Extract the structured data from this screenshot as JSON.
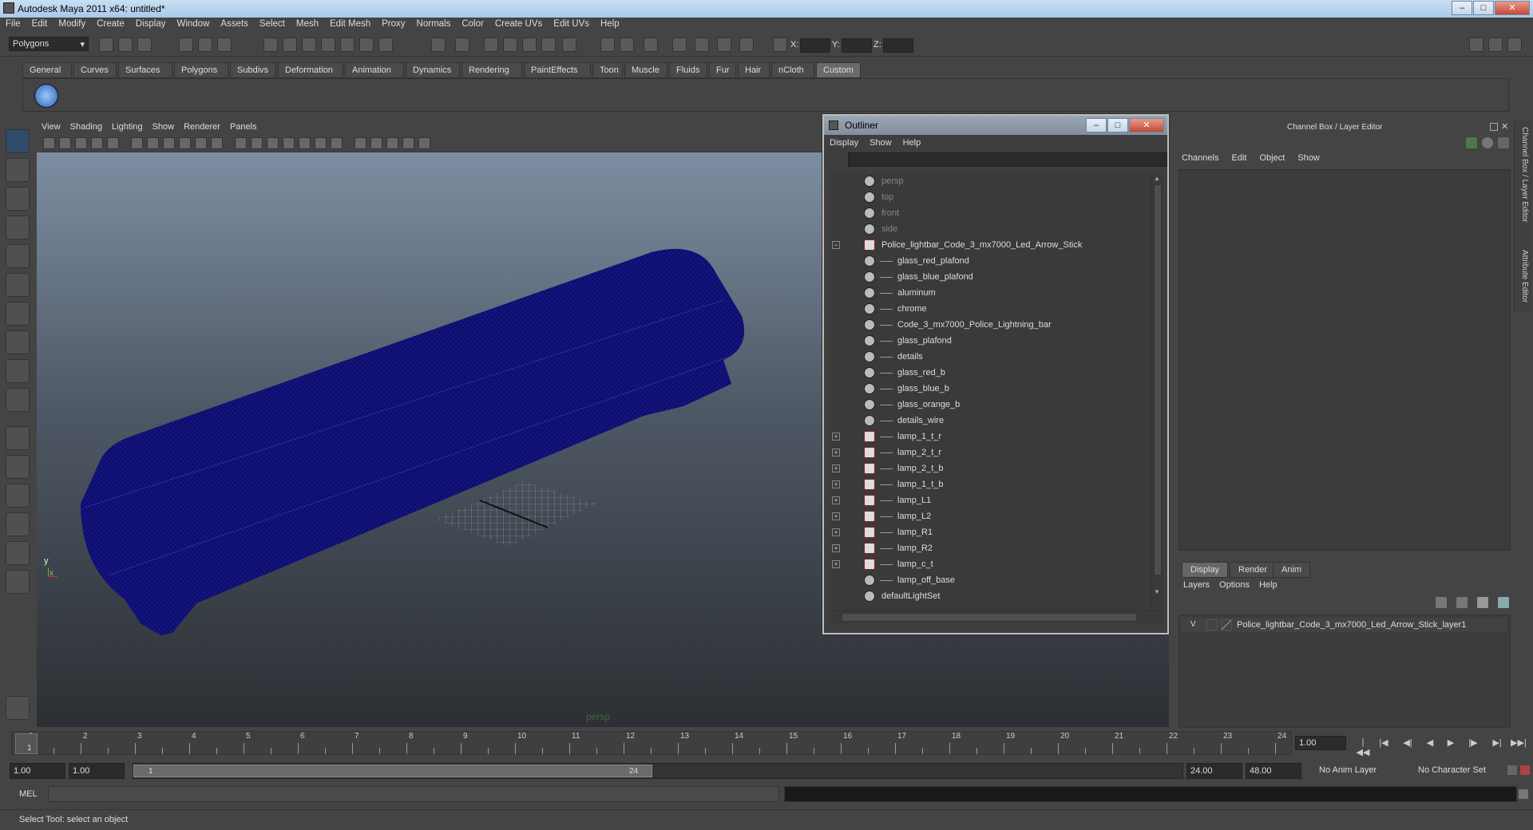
{
  "window": {
    "title": "Autodesk Maya 2011 x64: untitled*",
    "min": "–",
    "max": "□",
    "close": "✕"
  },
  "menubar": [
    "File",
    "Edit",
    "Modify",
    "Create",
    "Display",
    "Window",
    "Assets",
    "Select",
    "Mesh",
    "Edit Mesh",
    "Proxy",
    "Normals",
    "Color",
    "Create UVs",
    "Edit UVs",
    "Help"
  ],
  "statusline": {
    "mode": "Polygons",
    "x_label": "X:",
    "y_label": "Y:",
    "z_label": "Z:"
  },
  "shelf_tabs": [
    "General",
    "Curves",
    "Surfaces",
    "Polygons",
    "Subdivs",
    "Deformation",
    "Animation",
    "Dynamics",
    "Rendering",
    "PaintEffects",
    "Toon",
    "Muscle",
    "Fluids",
    "Fur",
    "Hair",
    "nCloth",
    "Custom"
  ],
  "shelf_active": "Custom",
  "viewport": {
    "menu": [
      "View",
      "Shading",
      "Lighting",
      "Show",
      "Renderer",
      "Panels"
    ],
    "camera_label": "persp",
    "axis_y": "y",
    "axis_x": "x",
    "model_color": "#0d0d6e"
  },
  "outliner": {
    "title": "Outliner",
    "menu": [
      "Display",
      "Show",
      "Help"
    ],
    "items": [
      {
        "label": "persp",
        "type": "camera"
      },
      {
        "label": "top",
        "type": "camera"
      },
      {
        "label": "front",
        "type": "camera"
      },
      {
        "label": "side",
        "type": "camera"
      },
      {
        "label": "Police_lightbar_Code_3_mx7000_Led_Arrow_Stick",
        "type": "group"
      },
      {
        "label": "glass_red_plafond",
        "type": "child"
      },
      {
        "label": "glass_blue_plafond",
        "type": "child"
      },
      {
        "label": "aluminum",
        "type": "child"
      },
      {
        "label": "chrome",
        "type": "child"
      },
      {
        "label": "Code_3_mx7000_Police_Lightning_bar",
        "type": "child"
      },
      {
        "label": "glass_plafond",
        "type": "child"
      },
      {
        "label": "details",
        "type": "child"
      },
      {
        "label": "glass_red_b",
        "type": "child"
      },
      {
        "label": "glass_blue_b",
        "type": "child"
      },
      {
        "label": "glass_orange_b",
        "type": "child"
      },
      {
        "label": "details_wire",
        "type": "child"
      },
      {
        "label": "lamp_1_t_r",
        "type": "subgroup"
      },
      {
        "label": "lamp_2_t_r",
        "type": "subgroup"
      },
      {
        "label": "lamp_2_t_b",
        "type": "subgroup"
      },
      {
        "label": "lamp_1_t_b",
        "type": "subgroup"
      },
      {
        "label": "lamp_L1",
        "type": "subgroup"
      },
      {
        "label": "lamp_L2",
        "type": "subgroup"
      },
      {
        "label": "lamp_R1",
        "type": "subgroup"
      },
      {
        "label": "lamp_R2",
        "type": "subgroup"
      },
      {
        "label": "lamp_c_t",
        "type": "subgroup"
      },
      {
        "label": "lamp_off_base",
        "type": "child"
      },
      {
        "label": "defaultLightSet",
        "type": "set"
      }
    ]
  },
  "channel_box": {
    "title": "Channel Box / Layer Editor",
    "menu": [
      "Channels",
      "Edit",
      "Object",
      "Show"
    ],
    "side_tab_1": "Channel Box / Layer Editor",
    "side_tab_2": "Attribute Editor"
  },
  "layer_editor": {
    "tabs": [
      "Display",
      "Render",
      "Anim"
    ],
    "active_tab": "Display",
    "menu": [
      "Layers",
      "Options",
      "Help"
    ],
    "layer": {
      "visible": "V",
      "name": "Police_lightbar_Code_3_mx7000_Led_Arrow_Stick_layer1"
    }
  },
  "timeline": {
    "ticks": [
      "1",
      "2",
      "3",
      "4",
      "5",
      "6",
      "7",
      "8",
      "9",
      "10",
      "11",
      "12",
      "13",
      "14",
      "15",
      "16",
      "17",
      "18",
      "19",
      "20",
      "21",
      "22",
      "23",
      "24"
    ],
    "current_frame_marker": "1",
    "current_time": "1.00"
  },
  "range": {
    "start": "1.00",
    "playback_start": "1.00",
    "handle_start": "1",
    "handle_end": "24",
    "playback_end": "24.00",
    "end": "48.00",
    "anim_layer": "No Anim Layer",
    "char_set": "No Character Set"
  },
  "command": {
    "label": "MEL"
  },
  "help_line": "Select Tool: select an object"
}
